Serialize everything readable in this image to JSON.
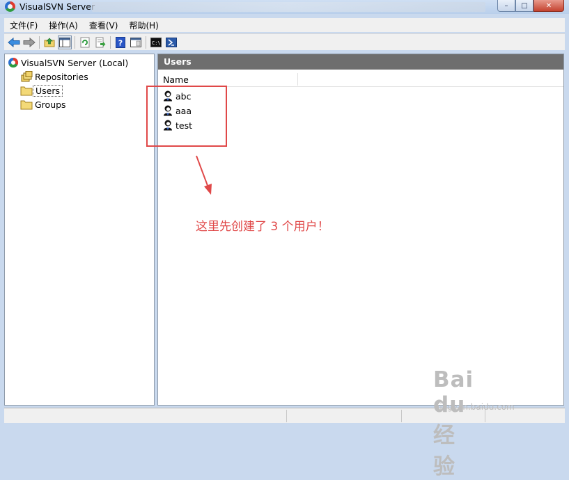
{
  "window": {
    "title": "VisualSVN Server",
    "minimize": "–",
    "maximize": "□",
    "close": "✕"
  },
  "menu": [
    "文件(F)",
    "操作(A)",
    "查看(V)",
    "帮助(H)"
  ],
  "tree": {
    "root": "VisualSVN Server (Local)",
    "items": [
      {
        "label": "Repositories"
      },
      {
        "label": "Users",
        "selected": true
      },
      {
        "label": "Groups"
      }
    ]
  },
  "panel": {
    "title": "Users",
    "column": "Name",
    "users": [
      "abc",
      "aaa",
      "test"
    ]
  },
  "annotation": {
    "text": "这里先创建了 3 个用户！",
    "color": "#e04848"
  },
  "watermark": {
    "logo": "Bai du 经验",
    "url": "jingyan.baidu.com"
  },
  "colors": {
    "header_bar": "#6e6e6e",
    "annotation": "#e04848"
  }
}
